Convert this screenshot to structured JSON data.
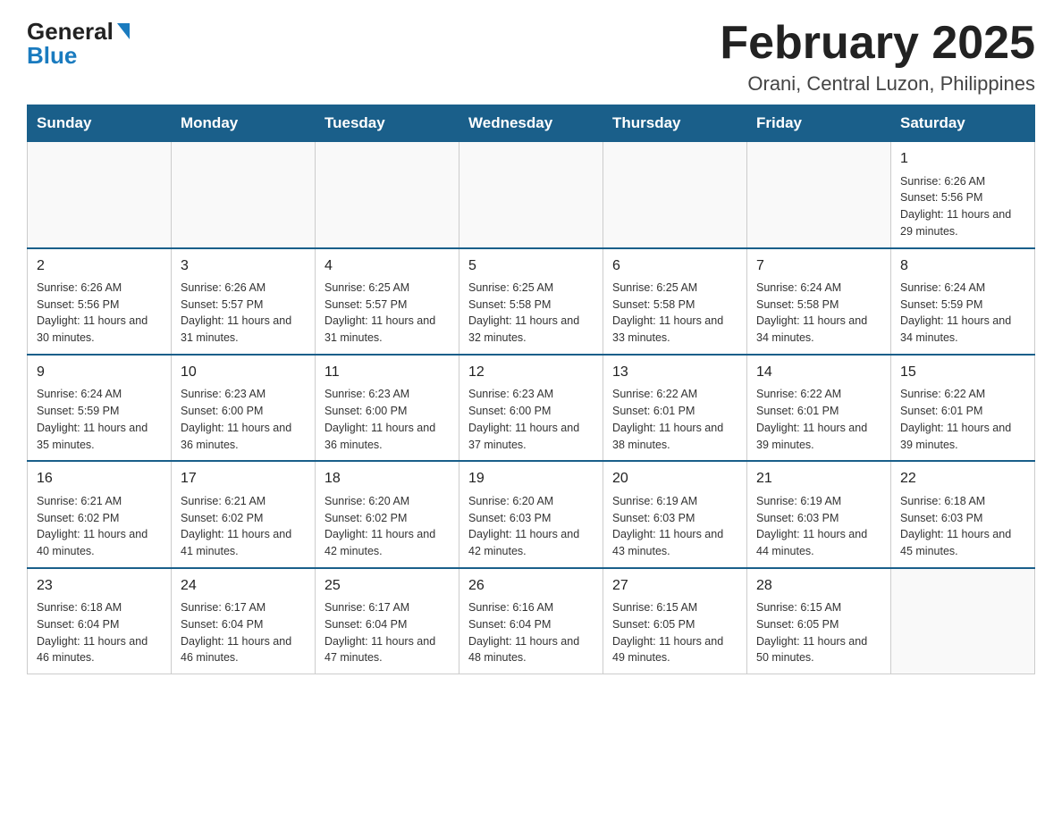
{
  "header": {
    "logo_general": "General",
    "logo_blue": "Blue",
    "month_title": "February 2025",
    "location": "Orani, Central Luzon, Philippines"
  },
  "days_of_week": [
    "Sunday",
    "Monday",
    "Tuesday",
    "Wednesday",
    "Thursday",
    "Friday",
    "Saturday"
  ],
  "weeks": [
    [
      {
        "day": "",
        "info": ""
      },
      {
        "day": "",
        "info": ""
      },
      {
        "day": "",
        "info": ""
      },
      {
        "day": "",
        "info": ""
      },
      {
        "day": "",
        "info": ""
      },
      {
        "day": "",
        "info": ""
      },
      {
        "day": "1",
        "info": "Sunrise: 6:26 AM\nSunset: 5:56 PM\nDaylight: 11 hours and 29 minutes."
      }
    ],
    [
      {
        "day": "2",
        "info": "Sunrise: 6:26 AM\nSunset: 5:56 PM\nDaylight: 11 hours and 30 minutes."
      },
      {
        "day": "3",
        "info": "Sunrise: 6:26 AM\nSunset: 5:57 PM\nDaylight: 11 hours and 31 minutes."
      },
      {
        "day": "4",
        "info": "Sunrise: 6:25 AM\nSunset: 5:57 PM\nDaylight: 11 hours and 31 minutes."
      },
      {
        "day": "5",
        "info": "Sunrise: 6:25 AM\nSunset: 5:58 PM\nDaylight: 11 hours and 32 minutes."
      },
      {
        "day": "6",
        "info": "Sunrise: 6:25 AM\nSunset: 5:58 PM\nDaylight: 11 hours and 33 minutes."
      },
      {
        "day": "7",
        "info": "Sunrise: 6:24 AM\nSunset: 5:58 PM\nDaylight: 11 hours and 34 minutes."
      },
      {
        "day": "8",
        "info": "Sunrise: 6:24 AM\nSunset: 5:59 PM\nDaylight: 11 hours and 34 minutes."
      }
    ],
    [
      {
        "day": "9",
        "info": "Sunrise: 6:24 AM\nSunset: 5:59 PM\nDaylight: 11 hours and 35 minutes."
      },
      {
        "day": "10",
        "info": "Sunrise: 6:23 AM\nSunset: 6:00 PM\nDaylight: 11 hours and 36 minutes."
      },
      {
        "day": "11",
        "info": "Sunrise: 6:23 AM\nSunset: 6:00 PM\nDaylight: 11 hours and 36 minutes."
      },
      {
        "day": "12",
        "info": "Sunrise: 6:23 AM\nSunset: 6:00 PM\nDaylight: 11 hours and 37 minutes."
      },
      {
        "day": "13",
        "info": "Sunrise: 6:22 AM\nSunset: 6:01 PM\nDaylight: 11 hours and 38 minutes."
      },
      {
        "day": "14",
        "info": "Sunrise: 6:22 AM\nSunset: 6:01 PM\nDaylight: 11 hours and 39 minutes."
      },
      {
        "day": "15",
        "info": "Sunrise: 6:22 AM\nSunset: 6:01 PM\nDaylight: 11 hours and 39 minutes."
      }
    ],
    [
      {
        "day": "16",
        "info": "Sunrise: 6:21 AM\nSunset: 6:02 PM\nDaylight: 11 hours and 40 minutes."
      },
      {
        "day": "17",
        "info": "Sunrise: 6:21 AM\nSunset: 6:02 PM\nDaylight: 11 hours and 41 minutes."
      },
      {
        "day": "18",
        "info": "Sunrise: 6:20 AM\nSunset: 6:02 PM\nDaylight: 11 hours and 42 minutes."
      },
      {
        "day": "19",
        "info": "Sunrise: 6:20 AM\nSunset: 6:03 PM\nDaylight: 11 hours and 42 minutes."
      },
      {
        "day": "20",
        "info": "Sunrise: 6:19 AM\nSunset: 6:03 PM\nDaylight: 11 hours and 43 minutes."
      },
      {
        "day": "21",
        "info": "Sunrise: 6:19 AM\nSunset: 6:03 PM\nDaylight: 11 hours and 44 minutes."
      },
      {
        "day": "22",
        "info": "Sunrise: 6:18 AM\nSunset: 6:03 PM\nDaylight: 11 hours and 45 minutes."
      }
    ],
    [
      {
        "day": "23",
        "info": "Sunrise: 6:18 AM\nSunset: 6:04 PM\nDaylight: 11 hours and 46 minutes."
      },
      {
        "day": "24",
        "info": "Sunrise: 6:17 AM\nSunset: 6:04 PM\nDaylight: 11 hours and 46 minutes."
      },
      {
        "day": "25",
        "info": "Sunrise: 6:17 AM\nSunset: 6:04 PM\nDaylight: 11 hours and 47 minutes."
      },
      {
        "day": "26",
        "info": "Sunrise: 6:16 AM\nSunset: 6:04 PM\nDaylight: 11 hours and 48 minutes."
      },
      {
        "day": "27",
        "info": "Sunrise: 6:15 AM\nSunset: 6:05 PM\nDaylight: 11 hours and 49 minutes."
      },
      {
        "day": "28",
        "info": "Sunrise: 6:15 AM\nSunset: 6:05 PM\nDaylight: 11 hours and 50 minutes."
      },
      {
        "day": "",
        "info": ""
      }
    ]
  ]
}
